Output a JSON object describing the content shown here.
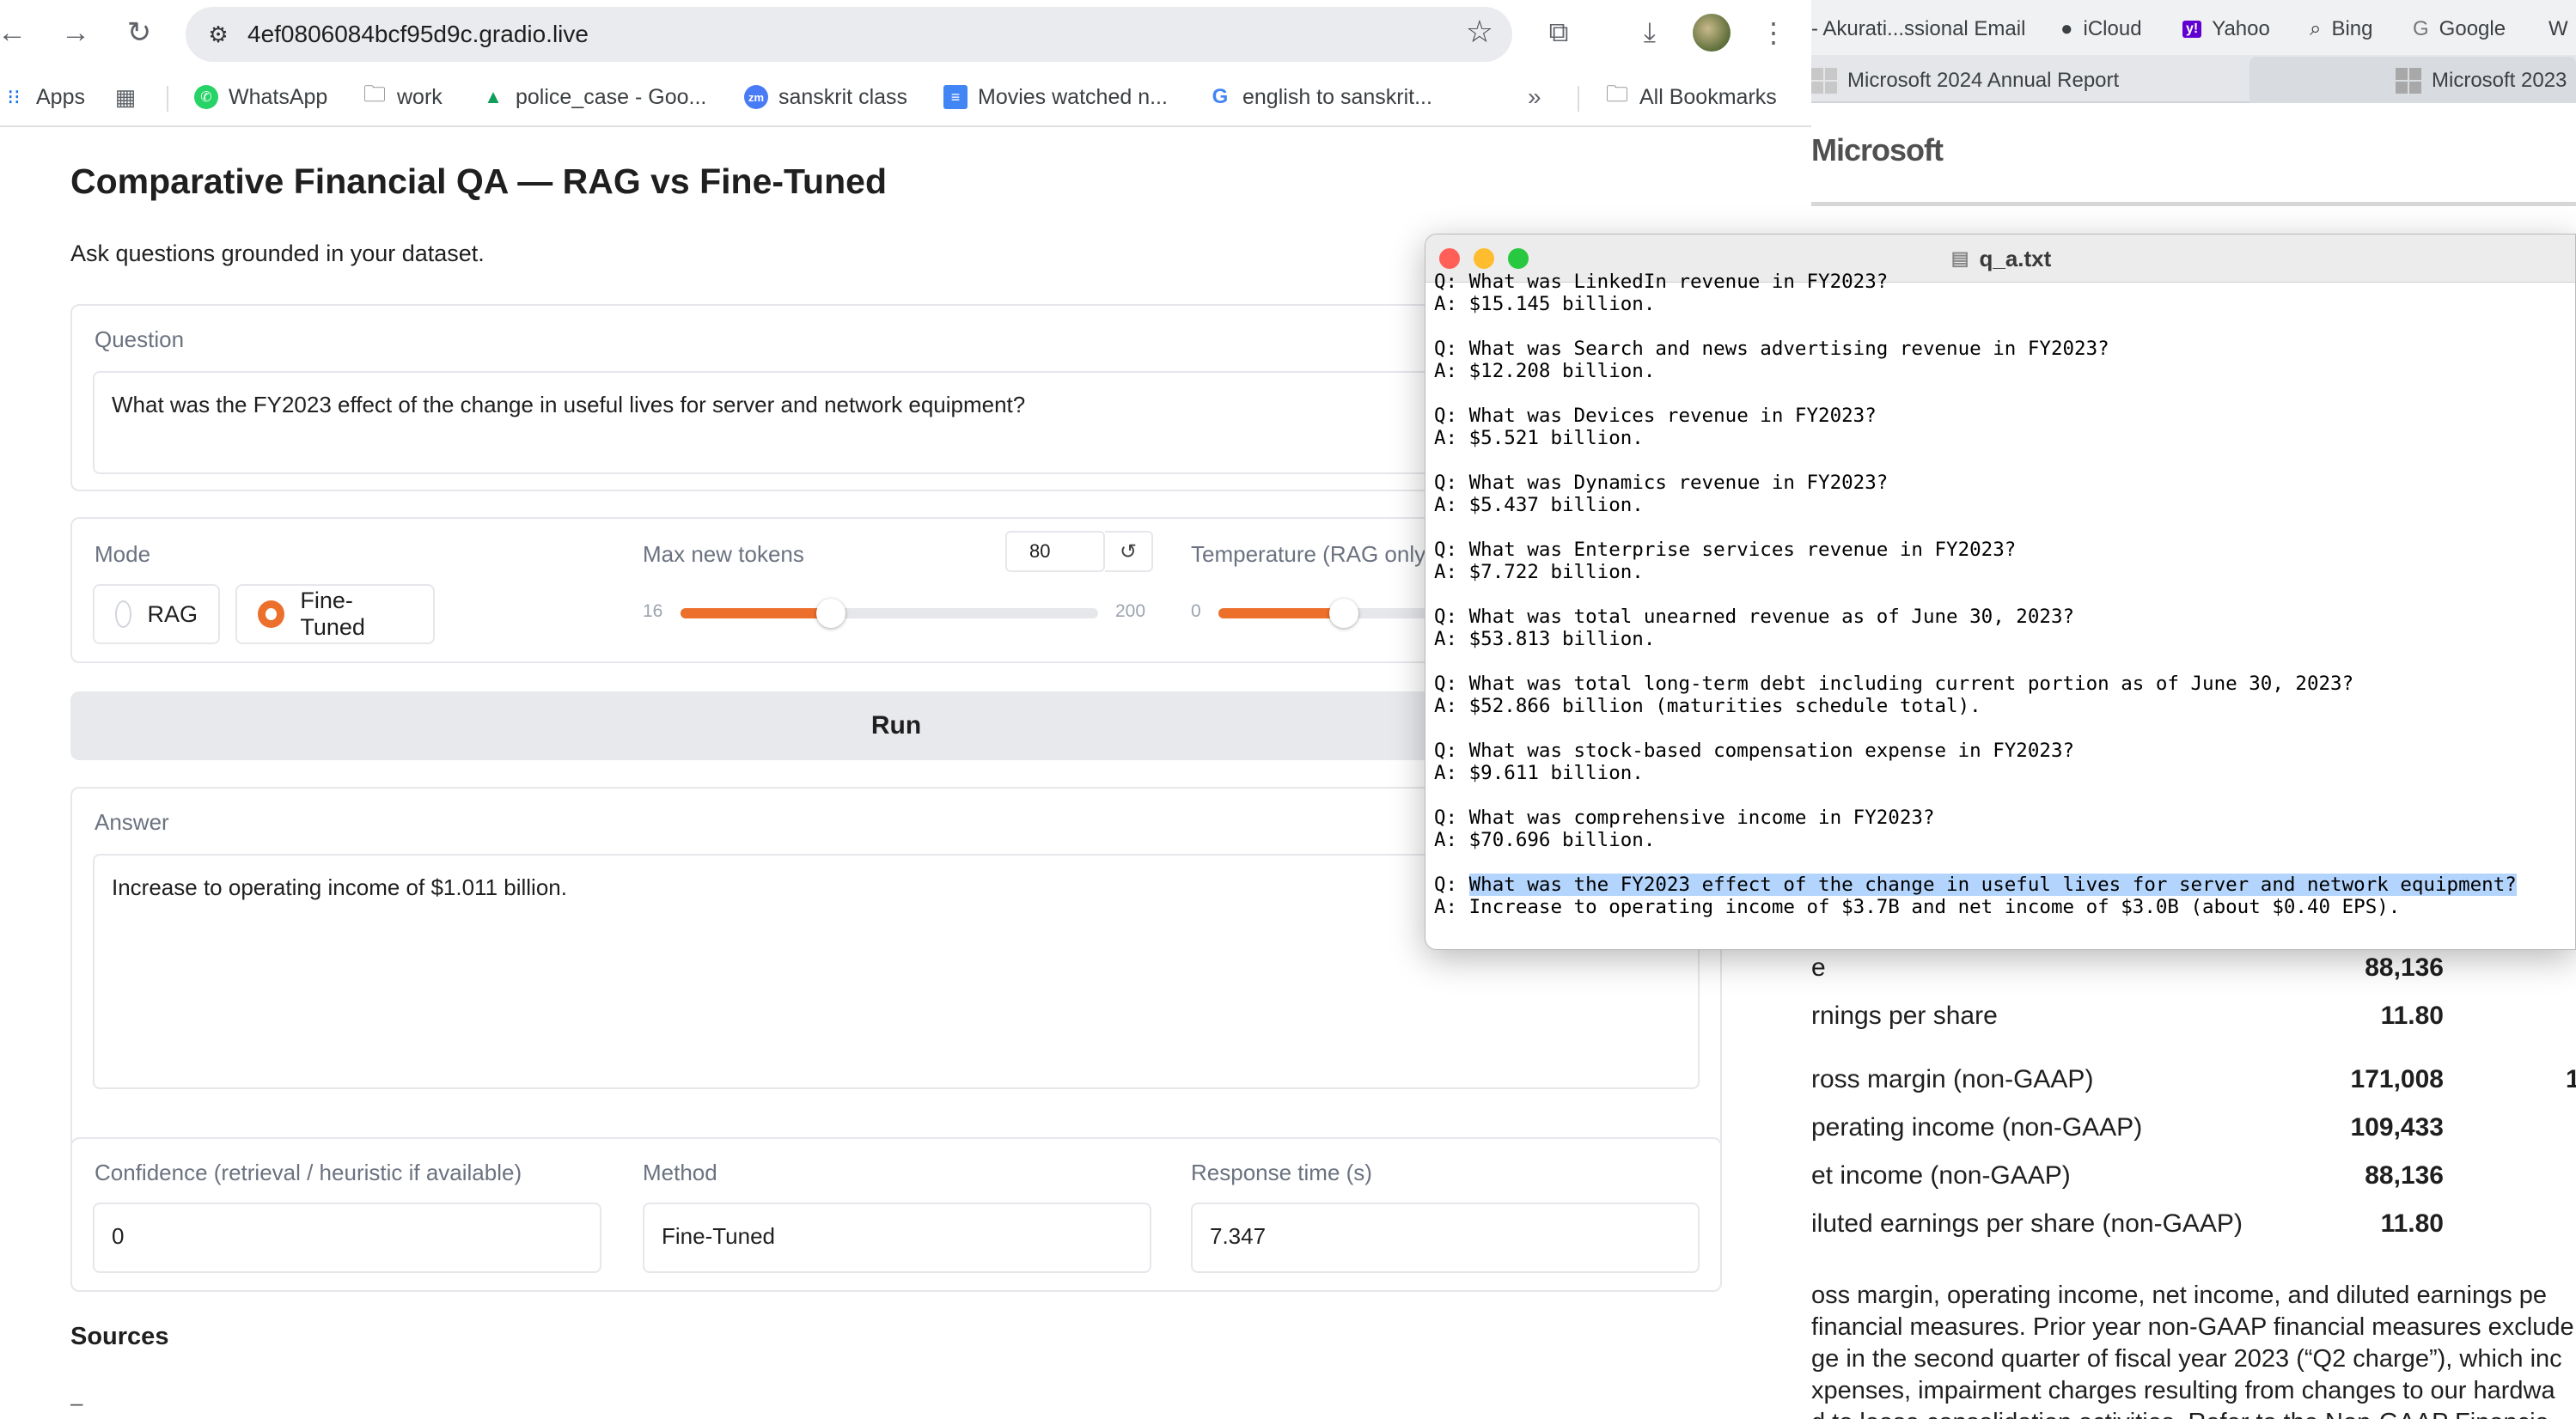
{
  "browser": {
    "url": "4ef0806084bcf95d9c.gradio.live",
    "bookmarks": [
      {
        "label": "Apps",
        "icon": "apps-grid-icon"
      },
      {
        "label": "WhatsApp",
        "icon": "whatsapp-icon"
      },
      {
        "label": "work",
        "icon": "folder-icon"
      },
      {
        "label": "police_case - Goo...",
        "icon": "google-drive-icon"
      },
      {
        "label": "sanskrit class",
        "icon": "zoom-icon"
      },
      {
        "label": "Movies watched n...",
        "icon": "google-docs-icon"
      },
      {
        "label": "english to sanskrit...",
        "icon": "google-icon"
      },
      {
        "label": "All Bookmarks",
        "icon": "folder-icon"
      }
    ],
    "overflow_label": "»"
  },
  "app": {
    "title": "Comparative Financial QA — RAG vs Fine-Tuned",
    "description": "Ask questions grounded in your dataset.",
    "question": {
      "label": "Question",
      "value": "What was the FY2023 effect of the change in useful lives for server and network equipment?"
    },
    "mode": {
      "label": "Mode",
      "options": [
        "RAG",
        "Fine-Tuned"
      ],
      "selected": "Fine-Tuned"
    },
    "max_tokens": {
      "label": "Max new tokens",
      "value": "80",
      "min": "16",
      "max": "200",
      "fraction": 0.36
    },
    "temperature": {
      "label": "Temperature (RAG only)",
      "min": "0",
      "fraction": 0.3
    },
    "run_label": "Run",
    "answer": {
      "label": "Answer",
      "value": "Increase to operating income of $1.011 billion."
    },
    "confidence": {
      "label": "Confidence (retrieval / heuristic if available)",
      "value": "0"
    },
    "method": {
      "label": "Method",
      "value": "Fine-Tuned"
    },
    "response_time": {
      "label": "Response time (s)",
      "value": "7.347"
    },
    "sources": {
      "label": "Sources",
      "value": "–"
    }
  },
  "background_window": {
    "bookmarks": [
      "- Akurati...ssional Email",
      "iCloud",
      "Yahoo",
      "Bing",
      "Google",
      "W"
    ],
    "tabs": [
      "Microsoft 2024 Annual Report",
      "Microsoft 2023"
    ],
    "brand": "Microsoft",
    "rows": [
      {
        "label": "e",
        "value": "88,136",
        "extra": ""
      },
      {
        "label": "rnings per share",
        "value": "11.80",
        "extra": ""
      },
      {
        "label": "ross margin (non-GAAP)",
        "value": "171,008",
        "extra": "1"
      },
      {
        "label": "perating income (non-GAAP)",
        "value": "109,433",
        "extra": ""
      },
      {
        "label": "et income (non-GAAP)",
        "value": "88,136",
        "extra": ""
      },
      {
        "label": "iluted earnings per share (non-GAAP)",
        "value": "11.80",
        "extra": ""
      }
    ],
    "paragraph": [
      "oss margin, operating income, net income, and diluted earnings pe",
      "financial measures. Prior year non-GAAP financial measures exclude",
      "ge in the second quarter of fiscal year 2023 (“Q2 charge”), which inc",
      "xpenses, impairment charges resulting from changes to our hardwa",
      "d to lease consolidation activities. Refer to the Non-GAAP Financia"
    ]
  },
  "text_editor": {
    "filename": "q_a.txt",
    "qa": [
      {
        "q": "Q: What was LinkedIn revenue in FY2023?",
        "a": "A: $15.145 billion."
      },
      {
        "q": "Q: What was Search and news advertising revenue in FY2023?",
        "a": "A: $12.208 billion."
      },
      {
        "q": "Q: What was Devices revenue in FY2023?",
        "a": "A: $5.521 billion."
      },
      {
        "q": "Q: What was Dynamics revenue in FY2023?",
        "a": "A: $5.437 billion."
      },
      {
        "q": "Q: What was Enterprise services revenue in FY2023?",
        "a": "A: $7.722 billion."
      },
      {
        "q": "Q: What was total unearned revenue as of June 30, 2023?",
        "a": "A: $53.813 billion."
      },
      {
        "q": "Q: What was total long-term debt including current portion as of June 30, 2023?",
        "a": "A: $52.866 billion (maturities schedule total)."
      },
      {
        "q": "Q: What was stock-based compensation expense in FY2023?",
        "a": "A: $9.611 billion."
      },
      {
        "q": "Q: What was comprehensive income in FY2023?",
        "a": "A: $70.696 billion."
      }
    ],
    "highlighted_prefix": "Q: ",
    "highlighted_q": "What was the FY2023 effect of the change in useful lives for server and network equipment?",
    "highlighted_a": "A: Increase to operating income of $3.7B and net income of $3.0B (about $0.40 EPS)."
  },
  "colors": {
    "accent": "#ec6f2c",
    "selection": "#b3d4fc",
    "close": "#ff5f57",
    "minimize": "#febc2e",
    "zoom": "#28c840"
  }
}
